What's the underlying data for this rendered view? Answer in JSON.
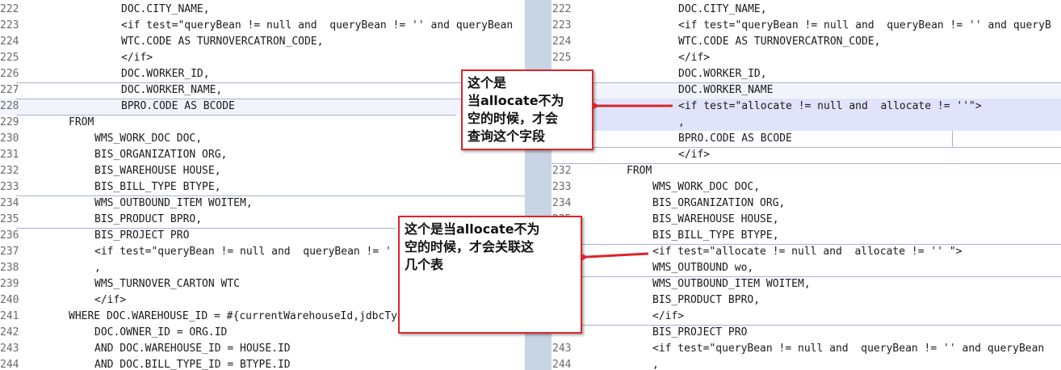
{
  "left": {
    "lines": [
      {
        "n": "222",
        "text": "DOC.CITY_NAME,",
        "indent": 150
      },
      {
        "n": "223",
        "text": "<if test=\"queryBean != null and  queryBean != '' and queryBean",
        "indent": 150
      },
      {
        "n": "224",
        "text": "WTC.CODE AS TURNOVERCATRON_CODE,",
        "indent": 150
      },
      {
        "n": "225",
        "text": "</if>",
        "indent": 150
      },
      {
        "n": "226",
        "text": "DOC.WORKER_ID,",
        "indent": 150
      },
      {
        "n": "227",
        "text": "DOC.WORKER_NAME,",
        "indent": 150
      },
      {
        "n": "228",
        "text": "BPRO.CODE AS BCODE",
        "indent": 150
      },
      {
        "n": "229",
        "text": "FROM",
        "indent": 85
      },
      {
        "n": "230",
        "text": "WMS_WORK_DOC DOC,",
        "indent": 117
      },
      {
        "n": "231",
        "text": "BIS_ORGANIZATION ORG,",
        "indent": 117
      },
      {
        "n": "232",
        "text": "BIS_WAREHOUSE HOUSE,",
        "indent": 117
      },
      {
        "n": "233",
        "text": "BIS_BILL_TYPE BTYPE,",
        "indent": 117
      },
      {
        "n": "234",
        "text": "WMS_OUTBOUND_ITEM WOITEM,",
        "indent": 117
      },
      {
        "n": "235",
        "text": "BIS_PRODUCT BPRO,",
        "indent": 117
      },
      {
        "n": "236",
        "text": "BIS_PROJECT PRO",
        "indent": 117
      },
      {
        "n": "237",
        "text": "<if test=\"queryBean != null and  queryBean != '",
        "indent": 117
      },
      {
        "n": "238",
        "text": ",",
        "indent": 117
      },
      {
        "n": "239",
        "text": "WMS_TURNOVER_CARTON WTC",
        "indent": 117
      },
      {
        "n": "240",
        "text": "</if>",
        "indent": 117
      },
      {
        "n": "241",
        "text": "WHERE DOC.WAREHOUSE_ID = #{currentWarehouseId,jdbcTy",
        "indent": 85
      },
      {
        "n": "242",
        "text": "DOC.OWNER_ID = ORG.ID",
        "indent": 117
      },
      {
        "n": "243",
        "text": "AND DOC.WAREHOUSE_ID = HOUSE.ID",
        "indent": 117
      },
      {
        "n": "244",
        "text": "AND DOC.BILL_TYPE_ID = BTYPE.ID",
        "indent": 117
      }
    ]
  },
  "right": {
    "lines": [
      {
        "n": "222",
        "text": "DOC.CITY_NAME,",
        "indent": 157
      },
      {
        "n": "223",
        "text": "<if test=\"queryBean != null and  queryBean != '' and queryB",
        "indent": 157
      },
      {
        "n": "224",
        "text": "WTC.CODE AS TURNOVERCATRON_CODE,",
        "indent": 157
      },
      {
        "n": "225",
        "text": "</if>",
        "indent": 157
      },
      {
        "n": "",
        "text": "DOC.WORKER_ID,",
        "indent": 157
      },
      {
        "n": "",
        "text": "DOC.WORKER_NAME",
        "indent": 157
      },
      {
        "n": "",
        "text": "<if test=\"allocate != null and  allocate != ''\">",
        "indent": 157
      },
      {
        "n": "",
        "text": ",",
        "indent": 157
      },
      {
        "n": "",
        "text": "BPRO.CODE AS BCODE",
        "indent": 157
      },
      {
        "n": "",
        "text": "</if>",
        "indent": 157
      },
      {
        "n": "232",
        "text": "FROM",
        "indent": 93
      },
      {
        "n": "233",
        "text": "WMS_WORK_DOC DOC,",
        "indent": 125
      },
      {
        "n": "234",
        "text": "BIS_ORGANIZATION ORG,",
        "indent": 125
      },
      {
        "n": "235",
        "text": "BIS_WAREHOUSE HOUSE,",
        "indent": 125
      },
      {
        "n": "",
        "text": "BIS_BILL_TYPE BTYPE,",
        "indent": 125
      },
      {
        "n": "",
        "text": "<if test=\"allocate != null and  allocate != '' \">",
        "indent": 125
      },
      {
        "n": "",
        "text": "WMS_OUTBOUND wo,",
        "indent": 125
      },
      {
        "n": "",
        "text": "WMS_OUTBOUND_ITEM WOITEM,",
        "indent": 125
      },
      {
        "n": "",
        "text": "BIS_PRODUCT BPRO,",
        "indent": 125
      },
      {
        "n": "",
        "text": "</if>",
        "indent": 125
      },
      {
        "n": "",
        "text": "BIS_PROJECT PRO",
        "indent": 125
      },
      {
        "n": "243",
        "text": "<if test=\"queryBean != null and  queryBean != '' and queryBean",
        "indent": 125
      },
      {
        "n": "244",
        "text": ",",
        "indent": 125
      }
    ]
  },
  "annotations": {
    "first": [
      "这个是",
      "当allocate不为",
      "空的时候，才会",
      "查询这个字段"
    ],
    "second": [
      "这个是当allocate不为",
      "空的时候，才会关联这",
      "几个表"
    ]
  },
  "colors": {
    "arrow": "#d8262b",
    "divider": "#c8d3e3",
    "highlight": "#dfe4fb"
  }
}
